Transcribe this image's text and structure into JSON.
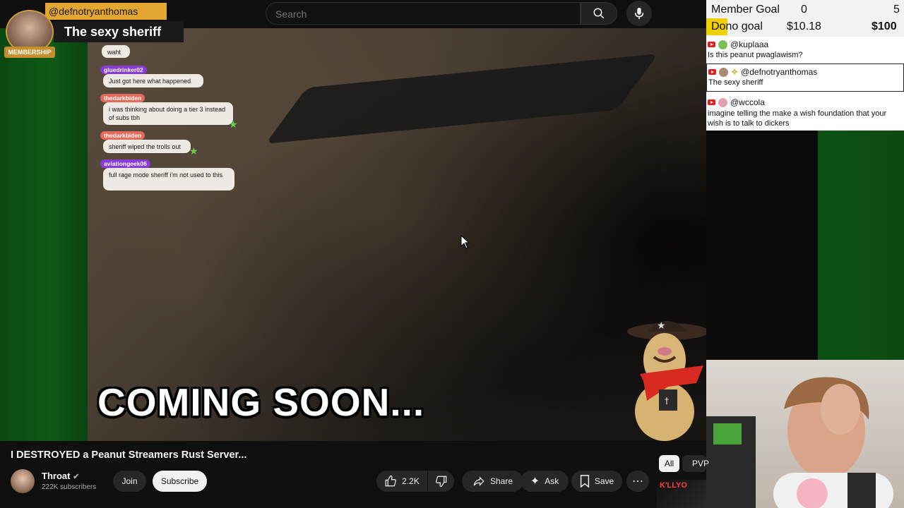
{
  "search": {
    "placeholder": "Search"
  },
  "membership": {
    "handle": "@defnotryanthomas",
    "message": "The sexy sheriff",
    "badge": "MEMBERSHIP"
  },
  "video_chat": [
    {
      "name": "",
      "text": "waht",
      "name_color": "#e0553c"
    },
    {
      "name": "gluedrinker02",
      "text": "Just got here what happened",
      "name_color": "#8a3ad8"
    },
    {
      "name": "thedarkbiden",
      "text": "i was thinking about doing a tier 3 instead of subs tbh",
      "name_color": "#e56a5a"
    },
    {
      "name": "thedarkbiden",
      "text": "sheriff wiped the trolls out",
      "name_color": "#e56a5a"
    },
    {
      "name": "aviationgeek06",
      "text": "full rage mode sheriff i'm not used to this",
      "name_color": "#8a3ad8"
    }
  ],
  "caption": "COMING SOON...",
  "goals": {
    "member": {
      "label": "Member Goal",
      "current": "0",
      "target": "5"
    },
    "dono": {
      "label": "Dono goal",
      "current": "$10.18",
      "target": "$100"
    }
  },
  "stream_chat": [
    {
      "user": "@kuplaaa",
      "text": "Is this peanut pwaglawism?",
      "avatar_color": "#7bbf5a"
    },
    {
      "user": "@defnotryanthomas",
      "text": "The sexy sheriff",
      "avatar_color": "#a98b74"
    },
    {
      "user": "@wccola",
      "text": "imagine telling the make a wish foundation that your wish is to talk to dickers",
      "avatar_color": "#e5a0b0"
    }
  ],
  "video": {
    "title": "I DESTROYED a Peanut Streamers Rust Server...",
    "channel": "Throat",
    "subscribers": "222K subscribers",
    "likes": "2.2K"
  },
  "actions": {
    "join": "Join",
    "subscribe": "Subscribe",
    "share": "Share",
    "ask": "Ask",
    "save": "Save"
  },
  "chips": {
    "all": "All",
    "pvp": "PVP"
  },
  "thumbnail_text": "K'LLYO"
}
